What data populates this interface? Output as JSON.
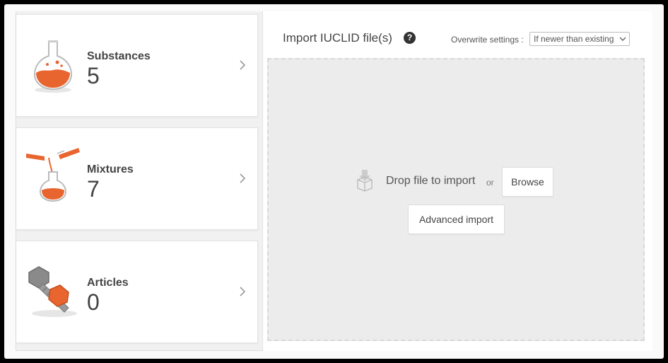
{
  "cards": [
    {
      "label": "Substances",
      "count": "5",
      "icon": "flask-icon"
    },
    {
      "label": "Mixtures",
      "count": "7",
      "icon": "pouring-flask-icon"
    },
    {
      "label": "Articles",
      "count": "0",
      "icon": "bolt-nut-icon"
    }
  ],
  "import": {
    "title": "Import IUCLID file(s)",
    "help": "?",
    "overwrite_label": "Overwrite settings :",
    "overwrite_value": "If newer than existing",
    "drop_text": "Drop file to import",
    "or_text": "or",
    "browse_label": "Browse",
    "advanced_label": "Advanced import"
  },
  "colors": {
    "accent": "#e9652f",
    "grey": "#8a8a8a"
  }
}
